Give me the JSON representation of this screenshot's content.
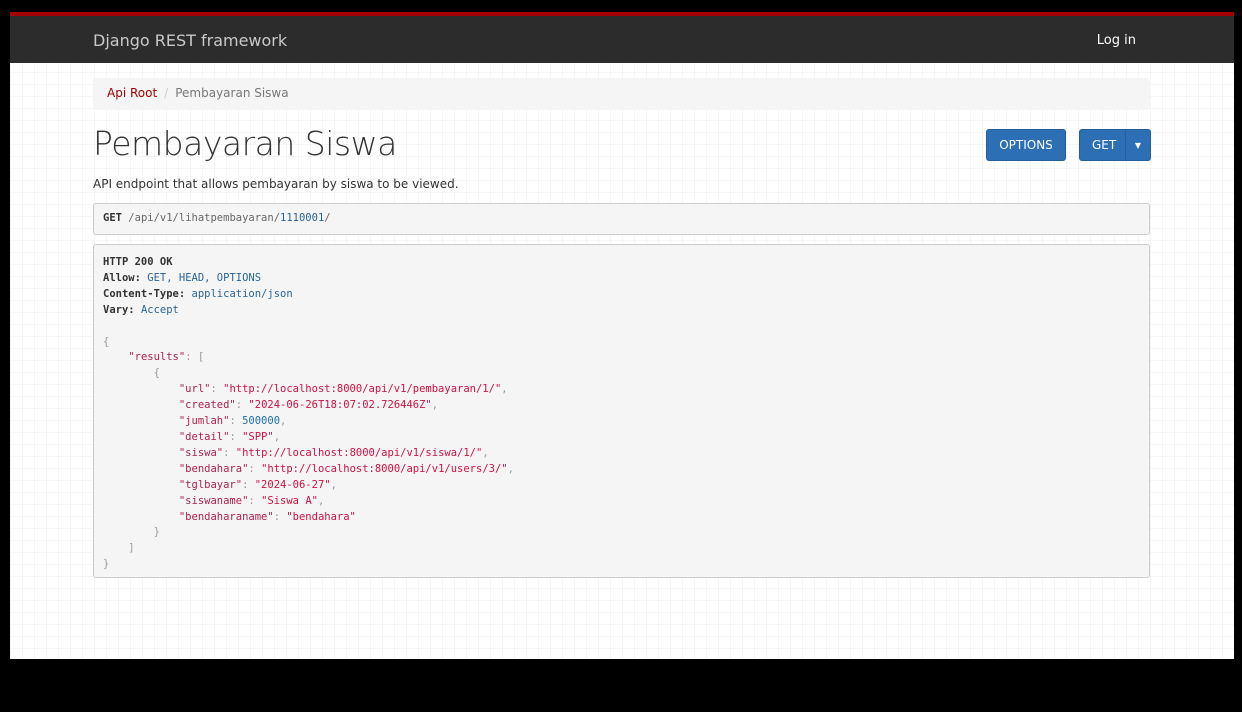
{
  "navbar": {
    "brand": "Django REST framework",
    "login": "Log in"
  },
  "breadcrumb": {
    "root": "Api Root",
    "current": "Pembayaran Siswa"
  },
  "page": {
    "title": "Pembayaran Siswa",
    "description": "API endpoint that allows pembayaran by siswa to be viewed.",
    "options_button": "OPTIONS",
    "get_button": "GET"
  },
  "request": {
    "method": "GET",
    "path": "/api/v1/lihatpembayaran/",
    "id": "1110001",
    "trailing": "/"
  },
  "response": {
    "status": "HTTP 200 OK",
    "headers": [
      {
        "name": "Allow:",
        "value": "GET, HEAD, OPTIONS"
      },
      {
        "name": "Content-Type:",
        "value": "application/json"
      },
      {
        "name": "Vary:",
        "value": "Accept"
      }
    ],
    "results_key": "\"results\"",
    "fields": [
      {
        "key": "\"url\"",
        "value": "\"http://localhost:8000/api/v1/pembayaran/1/\"",
        "type": "str"
      },
      {
        "key": "\"created\"",
        "value": "\"2024-06-26T18:07:02.726446Z\"",
        "type": "str"
      },
      {
        "key": "\"jumlah\"",
        "value": "500000",
        "type": "num"
      },
      {
        "key": "\"detail\"",
        "value": "\"SPP\"",
        "type": "str"
      },
      {
        "key": "\"siswa\"",
        "value": "\"http://localhost:8000/api/v1/siswa/1/\"",
        "type": "str"
      },
      {
        "key": "\"bendahara\"",
        "value": "\"http://localhost:8000/api/v1/users/3/\"",
        "type": "str"
      },
      {
        "key": "\"tglbayar\"",
        "value": "\"2024-06-27\"",
        "type": "str"
      },
      {
        "key": "\"siswaname\"",
        "value": "\"Siswa A\"",
        "type": "str"
      },
      {
        "key": "\"bendaharaname\"",
        "value": "\"bendahara\"",
        "type": "str"
      }
    ]
  },
  "colors": {
    "navbar_bg": "#2c2c2c",
    "accent": "#a30000",
    "button": "#2c6fb5"
  }
}
